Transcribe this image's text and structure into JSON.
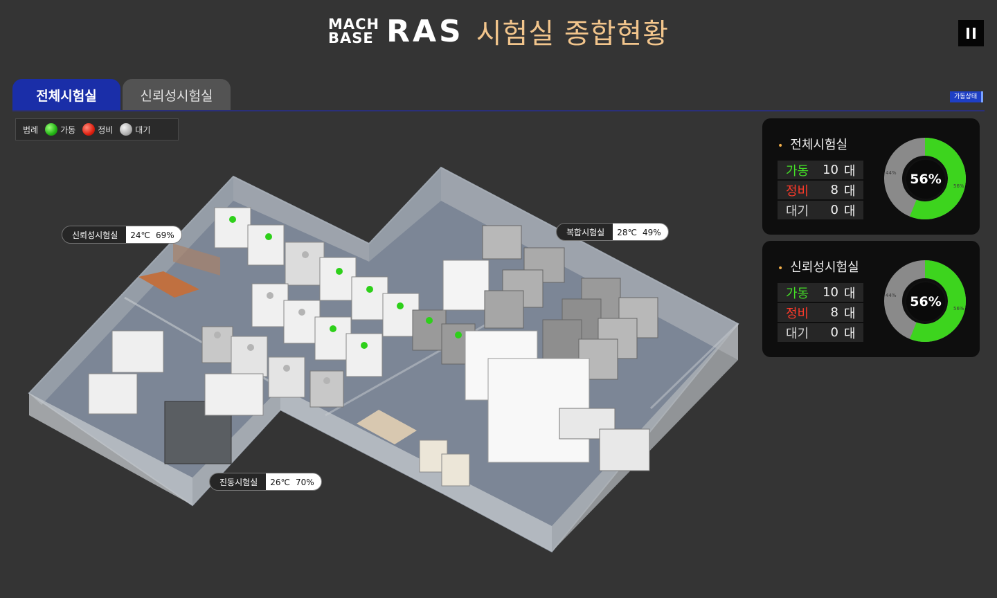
{
  "header": {
    "logo_line1": "MACH",
    "logo_line2": "BASE",
    "logo_ras": "RAS",
    "title": "시험실 종합현황",
    "pause_icon": "pause-icon"
  },
  "tabs": [
    {
      "label": "전체시험실",
      "active": true
    },
    {
      "label": "신뢰성시험실",
      "active": false
    }
  ],
  "op_status_label": "가동상태",
  "legend": {
    "title": "범례",
    "items": [
      {
        "label": "가동",
        "color": "#22b414"
      },
      {
        "label": "정비",
        "color": "#e02010"
      },
      {
        "label": "대기",
        "color": "#b0b0b0"
      }
    ]
  },
  "rooms": [
    {
      "name": "신뢰성시험실",
      "temp": "24℃",
      "humidity": "69%"
    },
    {
      "name": "복합시험실",
      "temp": "28℃",
      "humidity": "49%"
    },
    {
      "name": "진동시험실",
      "temp": "26℃",
      "humidity": "70%"
    }
  ],
  "panels": [
    {
      "title": "전체시험실",
      "rows": [
        {
          "label": "가동",
          "value": "10",
          "unit": "대",
          "color": "#44e026"
        },
        {
          "label": "정비",
          "value": "8",
          "unit": "대",
          "color": "#ff3a2a"
        },
        {
          "label": "대기",
          "value": "0",
          "unit": "대",
          "color": "#d8d8d8"
        }
      ],
      "percent": "56%",
      "percent_active": 56,
      "label_active": "56%",
      "label_inactive": "44%"
    },
    {
      "title": "신뢰성시험실",
      "rows": [
        {
          "label": "가동",
          "value": "10",
          "unit": "대",
          "color": "#44e026"
        },
        {
          "label": "정비",
          "value": "8",
          "unit": "대",
          "color": "#ff3a2a"
        },
        {
          "label": "대기",
          "value": "0",
          "unit": "대",
          "color": "#d8d8d8"
        }
      ],
      "percent": "56%",
      "percent_active": 56,
      "label_active": "56%",
      "label_inactive": "44%"
    }
  ],
  "colors": {
    "accent": "#1a2ea8",
    "title": "#f2c58c",
    "active": "#44e026",
    "maintenance": "#ff3a2a",
    "idle": "#9a9a9a"
  }
}
